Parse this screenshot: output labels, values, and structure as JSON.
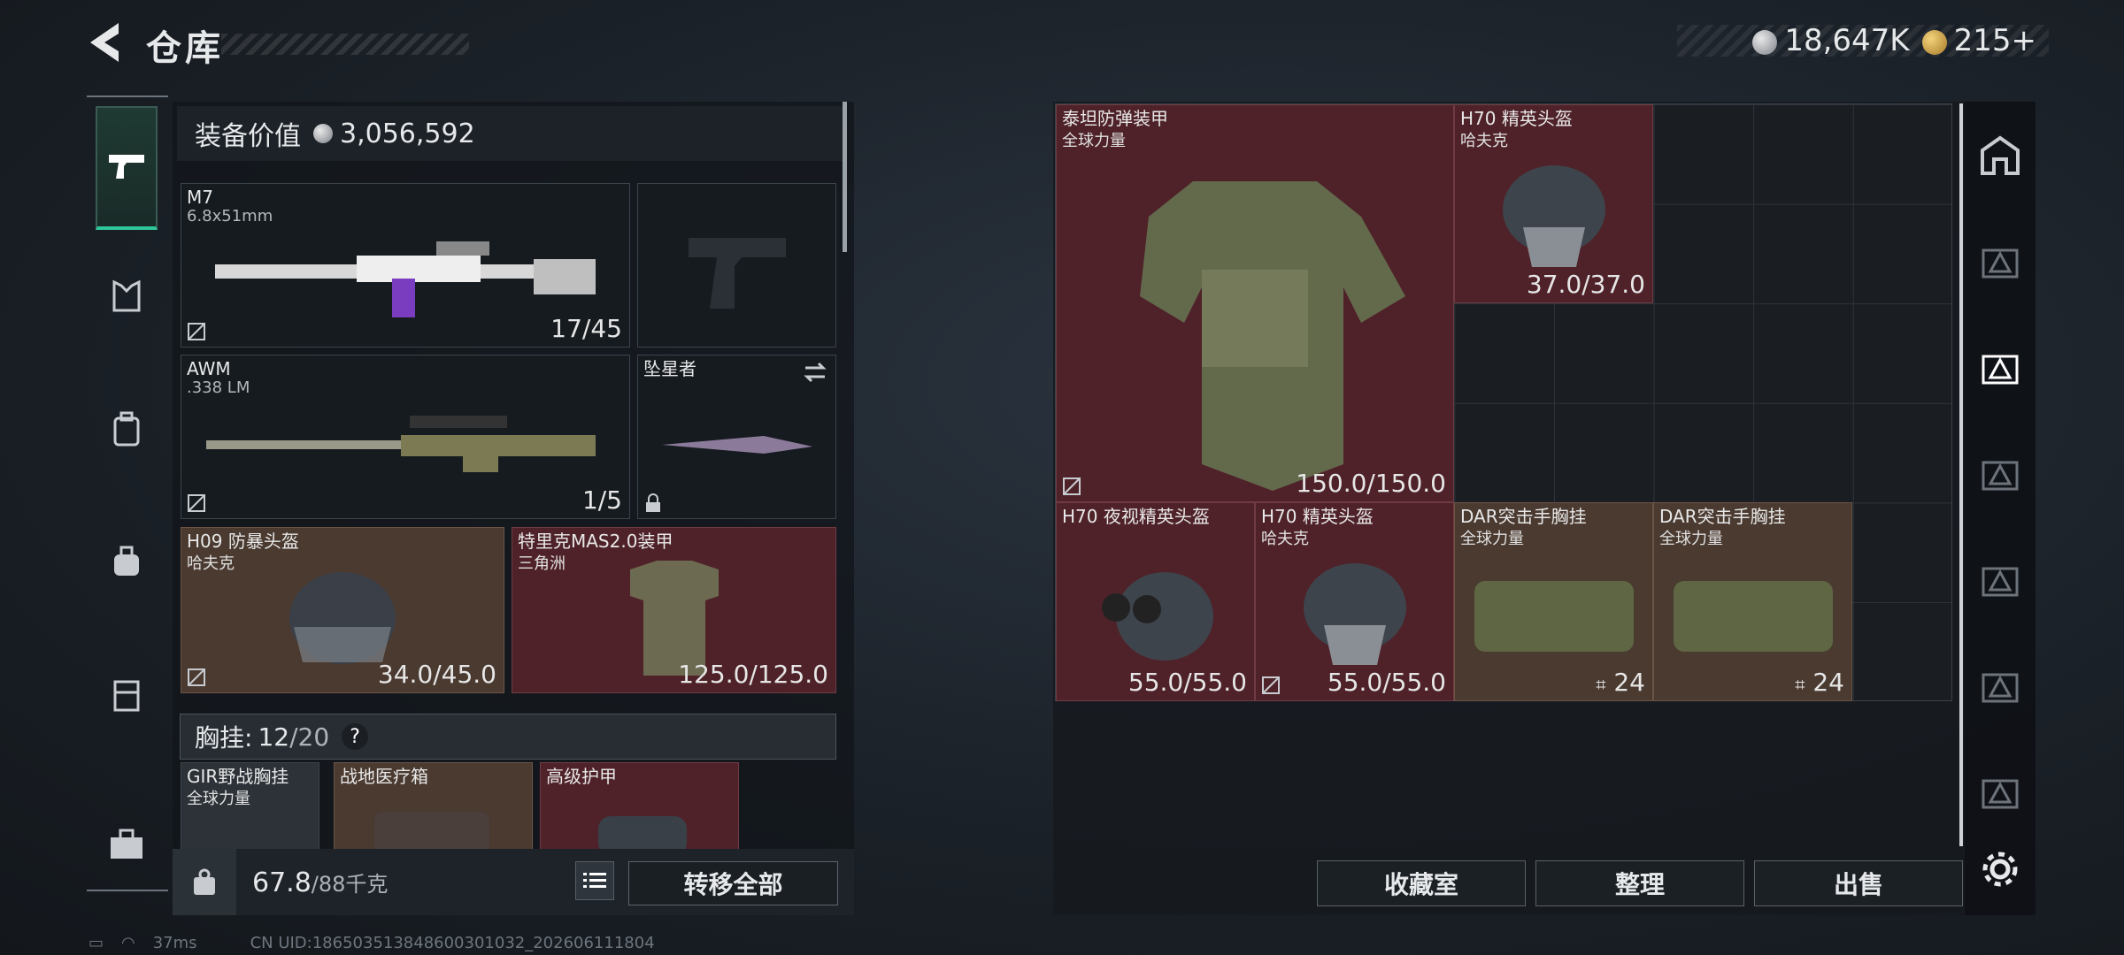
{
  "header": {
    "title": "仓库",
    "currency": [
      {
        "value": "18,647K",
        "icon": "silver-coin-icon"
      },
      {
        "value": "215+",
        "icon": "gold-coin-icon"
      }
    ]
  },
  "equipment": {
    "value_label": "装备价值",
    "value": "3,056,592",
    "slots": [
      {
        "name": "M7",
        "caliber": "6.8x51mm",
        "count": "17/45"
      },
      {
        "name": "",
        "caliber": "",
        "count": ""
      },
      {
        "name": "AWM",
        "caliber": ".338 LM",
        "count": "1/5"
      },
      {
        "name": "坠星者",
        "caliber": "",
        "count": ""
      },
      {
        "name": "H09 防暴头盔",
        "caliber": "哈夫克",
        "count": "34.0/45.0"
      },
      {
        "name": "特里克MAS2.0装甲",
        "caliber": "三角洲",
        "count": "125.0/125.0"
      }
    ]
  },
  "chest_rig": {
    "label": "胸挂:",
    "used": "12",
    "capacity": "/20",
    "help": "?",
    "items": [
      {
        "name": "GIR野战胸挂",
        "brand": "全球力量"
      },
      {
        "name": "战地医疗箱",
        "brand": ""
      },
      {
        "name": "高级护甲",
        "brand": ""
      }
    ]
  },
  "weight": {
    "current": "67.8",
    "capacity": "/88千克"
  },
  "buttons": {
    "transfer_all": "转移全部",
    "collection": "收藏室",
    "organize": "整理",
    "sell": "出售"
  },
  "stash": {
    "items": [
      {
        "name": "泰坦防弹装甲",
        "brand": "全球力量",
        "count": "150.0/150.0"
      },
      {
        "name": "H70 精英头盔",
        "brand": "哈夫克",
        "count": "37.0/37.0"
      },
      {
        "name": "H70 夜视精英头盔",
        "brand": "",
        "count": "55.0/55.0"
      },
      {
        "name": "H70 精英头盔",
        "brand": "哈夫克",
        "count": "55.0/55.0"
      },
      {
        "name": "DAR突击手胸挂",
        "brand": "全球力量",
        "count": "24"
      },
      {
        "name": "DAR突击手胸挂",
        "brand": "全球力量",
        "count": "24"
      }
    ]
  },
  "footer": {
    "ping": "37ms",
    "uid": "CN UID:18650351384860030103​2_202606111804"
  },
  "colors": {
    "accent": "#2ec79a",
    "rarity_red": "#4f2229",
    "rarity_tan": "#4a3a30"
  }
}
